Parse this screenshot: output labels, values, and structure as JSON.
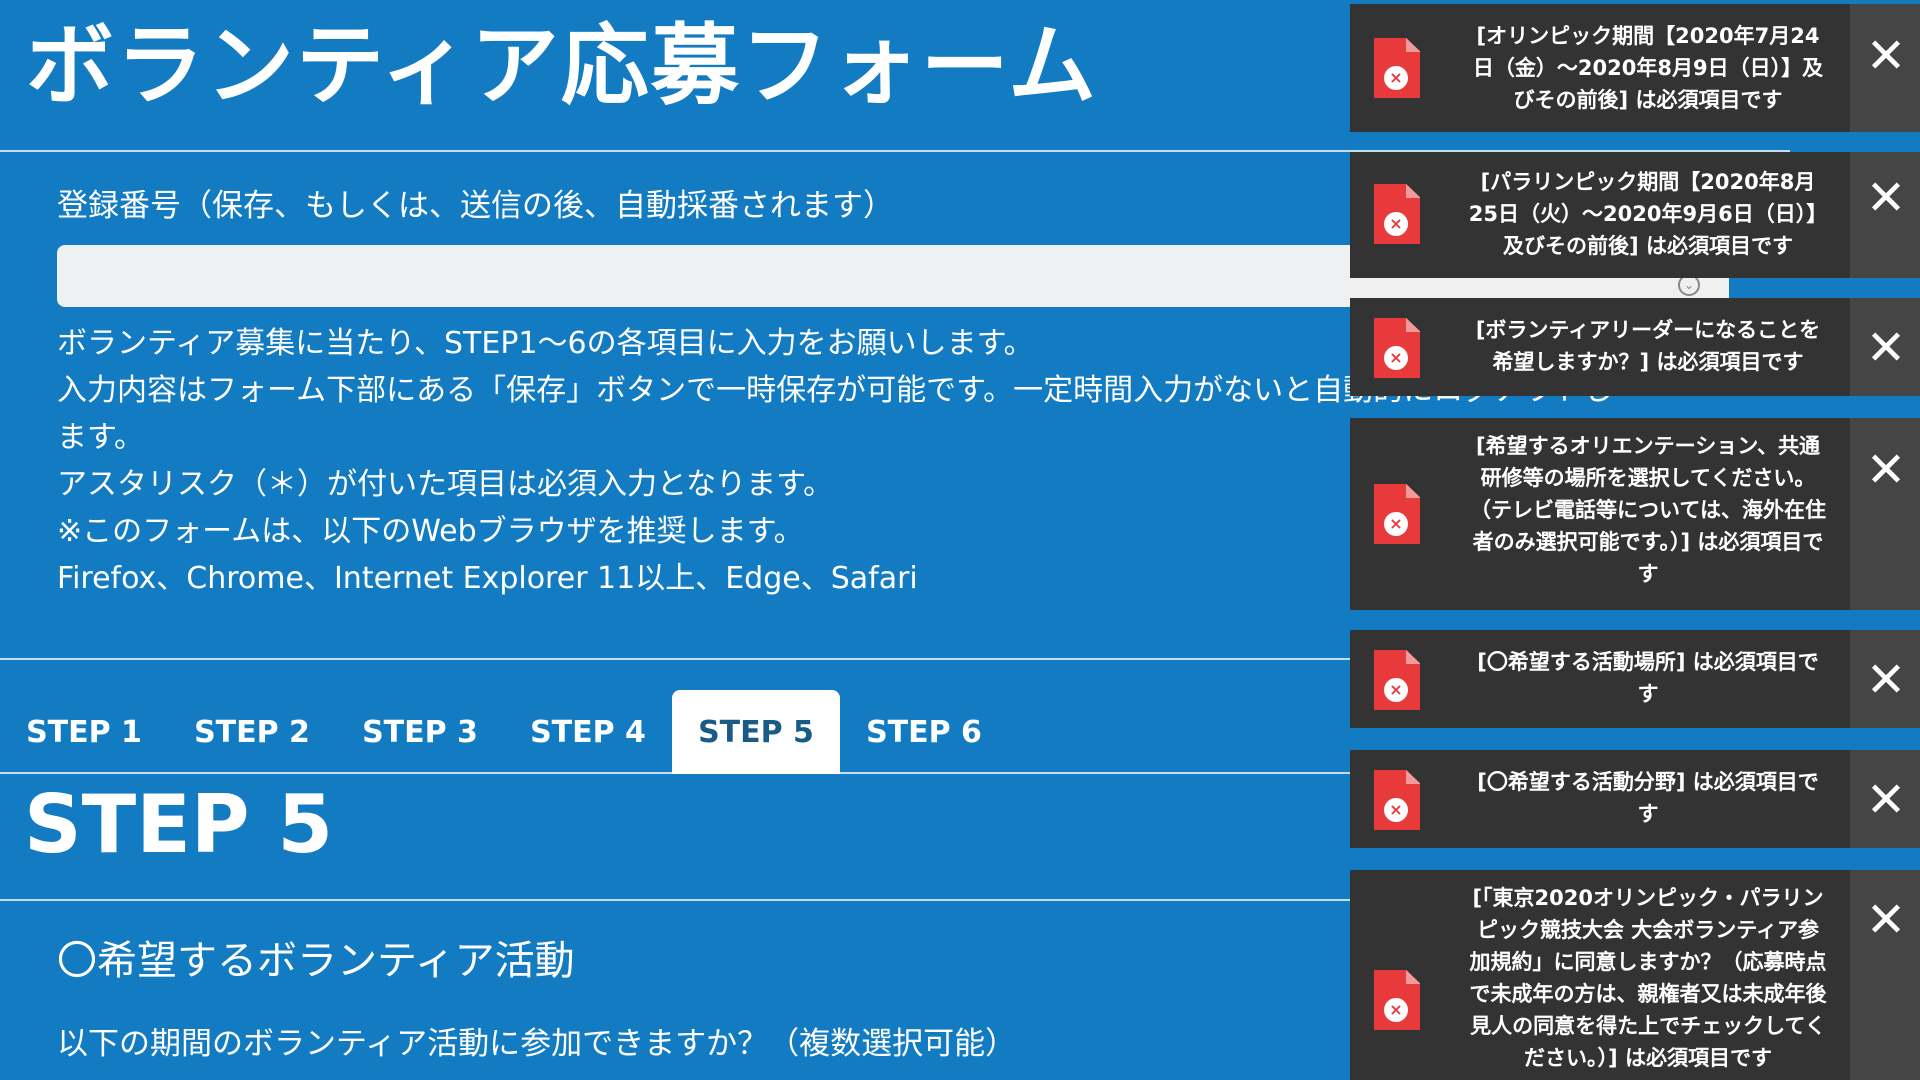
{
  "page": {
    "title": "ボランティア応募フォーム"
  },
  "registration": {
    "label": "登録番号（保存、もしくは、送信の後、自動採番されます）",
    "value": ""
  },
  "intro": {
    "line1": "ボランティア募集に当たり、STEP1〜6の各項目に入力をお願いします。",
    "line2": "入力内容はフォーム下部にある「保存」ボタンで一時保存が可能です。一定時間入力がないと自動的にログアウトし",
    "line3": "ます。",
    "line4": "アスタリスク（＊）が付いた項目は必須入力となります。",
    "line5": "※このフォームは、以下のWebブラウザを推奨します。",
    "line6": "Firefox、Chrome、Internet Explorer 11以上、Edge、Safari"
  },
  "tabs": [
    {
      "label": "STEP 1",
      "active": false
    },
    {
      "label": "STEP 2",
      "active": false
    },
    {
      "label": "STEP 3",
      "active": false
    },
    {
      "label": "STEP 4",
      "active": false
    },
    {
      "label": "STEP 5",
      "active": true
    },
    {
      "label": "STEP 6",
      "active": false
    }
  ],
  "step": {
    "heading": "STEP 5",
    "section_title": "〇希望するボランティア活動",
    "question": "以下の期間のボランティア活動に参加できますか？（複数選択可能）"
  },
  "toasts": [
    {
      "message": "[オリンピック期間【2020年7月24日（金）〜2020年8月9日（日）】及びその前後] は必須項目です",
      "close": "✕"
    },
    {
      "message": "[パラリンピック期間【2020年8月25日（火）〜2020年9月6日（日）】及びその前後] は必須項目です",
      "close": "✕"
    },
    {
      "message": "[ボランティアリーダーになることを希望しますか？] は必須項目です",
      "close": "✕"
    },
    {
      "message": "[希望するオリエンテーション、共通研修等の場所を選択してください。（テレビ電話等については、海外在住者のみ選択可能です。）] は必須項目です",
      "close": "✕"
    },
    {
      "message": "[〇希望する活動場所] は必須項目です",
      "close": "✕"
    },
    {
      "message": "[〇希望する活動分野] は必須項目です",
      "close": "✕"
    },
    {
      "message": "[「東京2020オリンピック・パラリンピック競技大会 大会ボランティア参加規約」に同意しますか？（応募時点で未成年の方は、親権者又は未成年後見人の同意を得た上でチェックしてください。）] は必須項目です",
      "close": "✕"
    }
  ],
  "colors": {
    "background": "#137bc2",
    "toast_background": "#333333",
    "toast_close_background": "#454545",
    "error_icon": "#e83a3a"
  },
  "icons": {
    "toast_icon": "file-error-icon",
    "close_icon": "close-icon",
    "dropdown_icon": "chevron-down-icon"
  }
}
